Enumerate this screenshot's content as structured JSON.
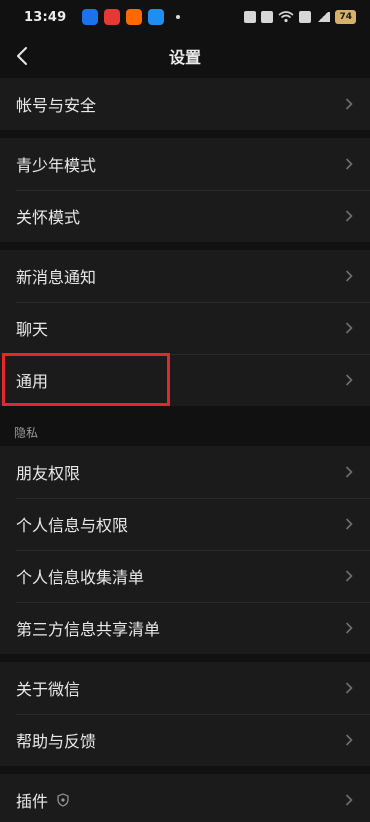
{
  "status": {
    "time": "13:49",
    "battery": "74",
    "app_icons": [
      "zhihu-icon",
      "jd-icon",
      "taobao-icon",
      "app-icon"
    ],
    "system_icons": [
      "alarm-icon",
      "bluetooth-icon",
      "wifi-icon",
      "hd-icon",
      "signal-icon"
    ]
  },
  "header": {
    "title": "设置",
    "back_icon": "chevron-left-icon"
  },
  "groups": {
    "account": [
      {
        "label": "帐号与安全"
      }
    ],
    "modes": [
      {
        "label": "青少年模式"
      },
      {
        "label": "关怀模式"
      }
    ],
    "general": [
      {
        "label": "新消息通知"
      },
      {
        "label": "聊天"
      },
      {
        "label": "通用"
      }
    ],
    "privacy_title": "隐私",
    "privacy": [
      {
        "label": "朋友权限"
      },
      {
        "label": "个人信息与权限"
      },
      {
        "label": "个人信息收集清单"
      },
      {
        "label": "第三方信息共享清单"
      }
    ],
    "about": [
      {
        "label": "关于微信"
      },
      {
        "label": "帮助与反馈"
      }
    ],
    "plugins": [
      {
        "label": "插件",
        "icon": "shield-icon"
      }
    ]
  },
  "colors": {
    "background": "#111111",
    "card": "#1b1b1b",
    "highlight": "#e0282f",
    "battery": "#d7b06a"
  }
}
